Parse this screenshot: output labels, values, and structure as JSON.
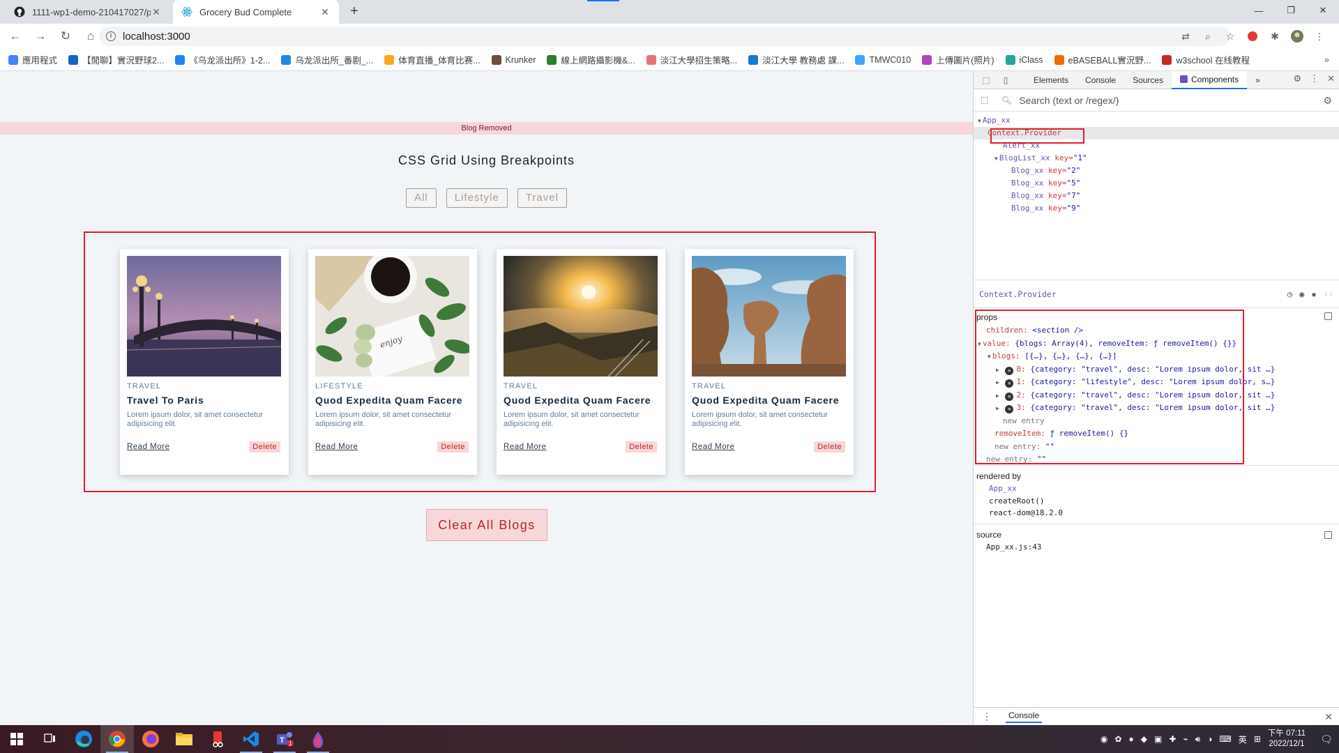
{
  "browser": {
    "tabs": [
      {
        "title": "1111-wp1-demo-210417027/p",
        "active": false
      },
      {
        "title": "Grocery Bud Complete",
        "active": true
      }
    ],
    "url": "localhost:3000",
    "bookmarks": [
      {
        "label": "應用程式",
        "color": "#4285f4"
      },
      {
        "label": "【閒聊】實況野球2...",
        "color": "#1565c0"
      },
      {
        "label": "《乌龙派出所》1-2...",
        "color": "#1e88e5"
      },
      {
        "label": "乌龙派出所_番剧_...",
        "color": "#1e88e5"
      },
      {
        "label": "体育直播_体育比赛...",
        "color": "#f9a825"
      },
      {
        "label": "Krunker",
        "color": "#6d4c41"
      },
      {
        "label": "線上網路攝影機&...",
        "color": "#2e7d32"
      },
      {
        "label": "淡江大學招生策略...",
        "color": "#e57373"
      },
      {
        "label": "淡江大學 教務處 課...",
        "color": "#1976d2"
      },
      {
        "label": "TMWC010",
        "color": "#42a5f5"
      },
      {
        "label": "上傳圖片(照片)",
        "color": "#ab47bc"
      },
      {
        "label": "iClass",
        "color": "#26a69a"
      },
      {
        "label": "eBASEBALL實況野...",
        "color": "#ef6c00"
      },
      {
        "label": "w3school 在线教程",
        "color": "#c62828"
      }
    ]
  },
  "page": {
    "alert": "Blog Removed",
    "title": "CSS Grid Using Breakpoints",
    "filters": [
      "All",
      "Lifestyle",
      "Travel"
    ],
    "cards": [
      {
        "category": "TRAVEL",
        "title": "Travel To Paris",
        "desc": "Lorem ipsum dolor, sit amet consectetur adipisicing elit.",
        "read_more": "Read More",
        "delete": "Delete"
      },
      {
        "category": "LIFESTYLE",
        "title": "Quod Expedita Quam Facere",
        "desc": "Lorem ipsum dolor, sit amet consectetur adipisicing elit.",
        "read_more": "Read More",
        "delete": "Delete"
      },
      {
        "category": "TRAVEL",
        "title": "Quod Expedita Quam Facere",
        "desc": "Lorem ipsum dolor, sit amet consectetur adipisicing elit.",
        "read_more": "Read More",
        "delete": "Delete"
      },
      {
        "category": "TRAVEL",
        "title": "Quod Expedita Quam Facere",
        "desc": "Lorem ipsum dolor, sit amet consectetur adipisicing elit.",
        "read_more": "Read More",
        "delete": "Delete"
      }
    ],
    "clear_button": "Clear All Blogs"
  },
  "devtools": {
    "tabs": [
      "Elements",
      "Console",
      "Sources",
      "Components"
    ],
    "search_placeholder": "Search (text or /regex/)",
    "tree": {
      "app": "App_xx",
      "provider": "Context.Provider",
      "alert": "Alert_xx",
      "bloglist": "BlogList_xx",
      "bloglist_key": "\"1\"",
      "blogs": [
        {
          "name": "Blog_xx",
          "key": "\"2\""
        },
        {
          "name": "Blog_xx",
          "key": "\"5\""
        },
        {
          "name": "Blog_xx",
          "key": "\"7\""
        },
        {
          "name": "Blog_xx",
          "key": "\"9\""
        }
      ],
      "key_label": "key="
    },
    "selected_component": "Context.Provider",
    "props": {
      "title": "props",
      "children_key": "children:",
      "children_val": "<section />",
      "value_key": "value:",
      "value_val": "{blogs: Array(4), removeItem: ƒ removeItem() {}}",
      "blogs_key": "blogs:",
      "blogs_val": "[{…}, {…}, {…}, {…}]",
      "items": [
        {
          "idx": "0:",
          "val": "{category: \"travel\", desc: \"Lorem ipsum dolor, sit …}"
        },
        {
          "idx": "1:",
          "val": "{category: \"lifestyle\", desc: \"Lorem ipsum dolor, s…}"
        },
        {
          "idx": "2:",
          "val": "{category: \"travel\", desc: \"Lorem ipsum dolor, sit …}"
        },
        {
          "idx": "3:",
          "val": "{category: \"travel\", desc: \"Lorem ipsum dolor, sit …}"
        }
      ],
      "new_entry_1": "new entry",
      "remove_key": "removeItem:",
      "remove_val": "ƒ removeItem() {}",
      "new_entry_2_key": "new entry:",
      "new_entry_2_val": "\"\"",
      "new_entry_3_key": "new entry:",
      "new_entry_3_val": "\"\""
    },
    "rendered_by": {
      "title": "rendered by",
      "lines": [
        "App_xx",
        "createRoot()",
        "react-dom@18.2.0"
      ]
    },
    "source": {
      "title": "source",
      "line": "App_xx.js:43"
    },
    "console_label": "Console"
  },
  "taskbar": {
    "time": "下午 07:11",
    "date": "2022/12/1",
    "ime": "英"
  }
}
